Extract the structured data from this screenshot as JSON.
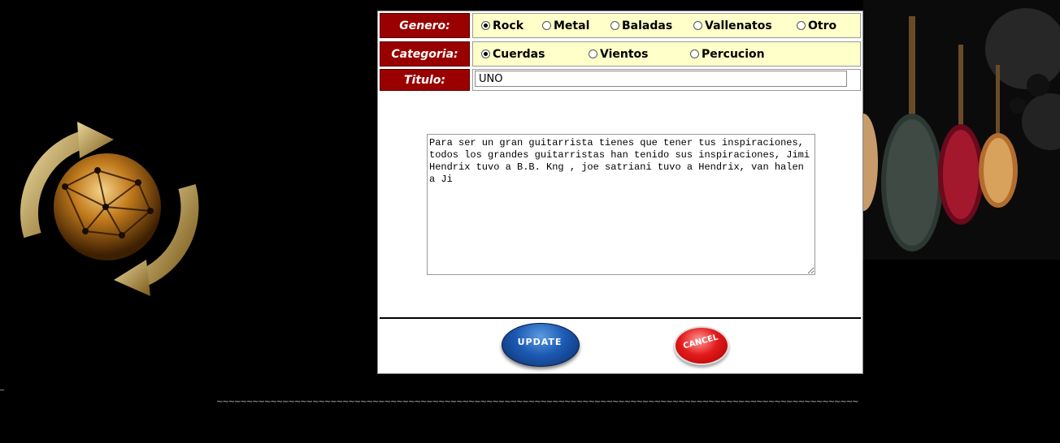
{
  "form": {
    "genero": {
      "label": "Genero:",
      "options": [
        "Rock",
        "Metal",
        "Baladas",
        "Vallenatos",
        "Otro"
      ],
      "selected": "Rock"
    },
    "categoria": {
      "label": "Categoria:",
      "options": [
        "Cuerdas",
        "Vientos",
        "Percucion"
      ],
      "selected": "Cuerdas"
    },
    "titulo": {
      "label": "Titulo:",
      "value": "UNO"
    },
    "descripcion": {
      "value": "Para ser un gran guitarrista tienes que tener tus inspiraciones, todos los grandes guitarristas han tenido sus inspiraciones, Jimi Hendrix tuvo a B.B. Kng , joe satriani tuvo a Hendrix, van halen a Ji"
    },
    "buttons": {
      "update": "UPDATE",
      "cancel": "CANCEL"
    }
  },
  "footer": {
    "divider": "~~~~~~~~~~~~~~~~~~~~~~~~~~~~~~~~~~~~~~~~~~~~~~~~~~~~~~~~~~~~~~~~~~~~~~~~~~~~~~~~~~~~~~~~~~~~~~~~~~~~~~~~~~~~~~~~~~~~~~~~~~~~~~~~~~~~~~~~~~~~~~~~~~~~~~~~~~~~~~~~~~~~~~~~~~~~~~~~~~~~~~~~~~~~~~~~~~~~~~~~~~~~~~~~~~~~~~~~~~",
    "mark": "_"
  },
  "icons": {
    "logo": "globe-refresh-icon",
    "guitars": "guitars-image"
  },
  "colors": {
    "label_bg": "#9a0000",
    "field_bg": "#ffffc9"
  }
}
